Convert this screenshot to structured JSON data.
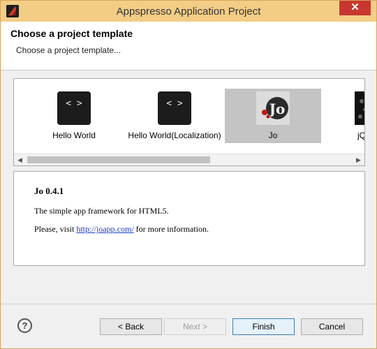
{
  "window": {
    "title": "Appspresso Application Project",
    "close_label": "✕"
  },
  "banner": {
    "title": "Choose a project template",
    "subtitle": "Choose a project template..."
  },
  "templates": [
    {
      "label": "Hello World",
      "glyph": "< >"
    },
    {
      "label": "Hello World(Localization)",
      "glyph": "< >"
    },
    {
      "label": "Jo",
      "glyph": "Jo",
      "selected": true
    },
    {
      "label": "jQ",
      "glyph": ""
    }
  ],
  "scrollbar": {
    "left_arrow": "◀",
    "right_arrow": "▶"
  },
  "description": {
    "title": "Jo 0.4.1",
    "line1": "The simple app framework for HTML5.",
    "line2_prefix": "Please, visit ",
    "link": "http://joapp.com/",
    "line2_suffix": " for more information."
  },
  "footer": {
    "help_label": "?",
    "back_label": "< Back",
    "next_label": "Next >",
    "finish_label": "Finish",
    "cancel_label": "Cancel"
  },
  "colors": {
    "titlebar": "#f3cd86",
    "selected_tile": "#c4c4c4",
    "link": "#1a3cc6",
    "close": "#c7372f"
  }
}
